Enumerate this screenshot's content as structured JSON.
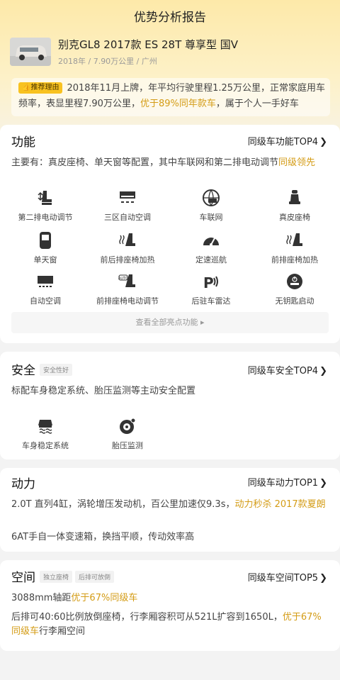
{
  "header": {
    "title": "优势分析报告"
  },
  "car": {
    "name": "别克GL8 2017款 ES 28T 尊享型 国V",
    "sub": "2018年 / 7.90万公里 / 广州"
  },
  "reason": {
    "badge": "推荐理由",
    "text_a": "2018年11月上牌，年平均行驶里程1.25万公里，正常家庭用车频率，表显里程7.90万公里，",
    "highlight": "优于89%同年款车",
    "text_b": "，属于个人一手好车"
  },
  "function": {
    "title": "功能",
    "rank": "同级车功能TOP4",
    "desc_a": "主要有：真皮座椅、单天窗等配置，其中车联网和第二排电动调节",
    "desc_hl": "同级领先",
    "items": [
      {
        "label": "第二排电动调节",
        "icon": "seat-adjust-icon"
      },
      {
        "label": "三区自动空调",
        "icon": "climate-zones-icon"
      },
      {
        "label": "车联网",
        "icon": "connected-car-icon"
      },
      {
        "label": "真皮座椅",
        "icon": "leather-seat-icon"
      },
      {
        "label": "单天窗",
        "icon": "sunroof-icon"
      },
      {
        "label": "前后排座椅加热",
        "icon": "seat-heat-icon"
      },
      {
        "label": "定速巡航",
        "icon": "cruise-control-icon"
      },
      {
        "label": "前排座椅加热",
        "icon": "front-seat-heat-icon"
      },
      {
        "label": "自动空调",
        "icon": "auto-ac-icon"
      },
      {
        "label": "前排座椅电动调节",
        "icon": "auto-seat-icon"
      },
      {
        "label": "后驻车雷达",
        "icon": "parking-radar-icon"
      },
      {
        "label": "无钥匙启动",
        "icon": "keyless-start-icon"
      }
    ],
    "view_all": "查看全部亮点功能 ▸"
  },
  "safety": {
    "title": "安全",
    "tag": "安全性好",
    "rank": "同级车安全TOP4",
    "desc": "标配车身稳定系统、胎压监测等主动安全配置",
    "items": [
      {
        "label": "车身稳定系统",
        "icon": "stability-icon"
      },
      {
        "label": "胎压监测",
        "icon": "tire-pressure-icon"
      }
    ]
  },
  "power": {
    "title": "动力",
    "rank": "同级车动力TOP1",
    "desc1_a": "2.0T 直列4缸，涡轮增压发动机，百公里加速仅9.3s，",
    "desc1_hl": "动力秒杀 2017款夏朗",
    "desc2": "6AT手自一体变速箱，换挡平顺，传动效率高"
  },
  "space": {
    "title": "空间",
    "tags": [
      "独立座椅",
      "后排可放倒"
    ],
    "rank": "同级车空间TOP5",
    "desc1_a": "3088mm轴距",
    "desc1_hl": "优于67%同级车",
    "desc2_a": "后排可40:60比例放倒座椅，行李厢容积可从521L扩容到1650L，",
    "desc2_hl": "优于67%同级车",
    "desc2_b": "行李厢空间"
  },
  "colors": {
    "accent": "#d49c16",
    "badge": "#f8c220",
    "hero_top": "#fde9a9"
  }
}
